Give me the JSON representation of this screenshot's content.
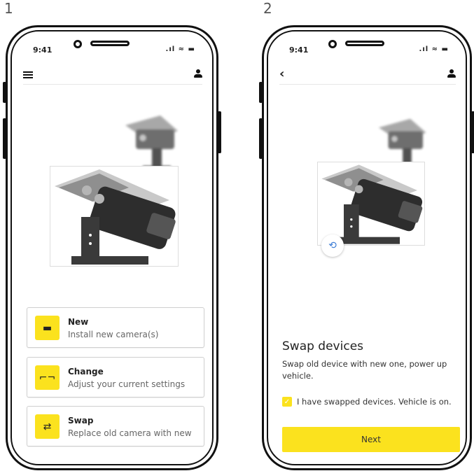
{
  "steps": {
    "first": "1",
    "second": "2"
  },
  "status_bar": {
    "time": "9:41",
    "icons_glyphs": ".ıl ≈ ▬"
  },
  "screen1": {
    "menu_icon": "hamburger-menu-icon",
    "profile_icon": "user-icon",
    "options": [
      {
        "title": "New",
        "subtitle": "Install new camera(s)",
        "icon": "camera-card-icon",
        "glyph": "▬"
      },
      {
        "title": "Change",
        "subtitle": "Adjust your current settings",
        "icon": "frame-adjust-icon",
        "glyph": "⌐¬"
      },
      {
        "title": "Swap",
        "subtitle": "Replace old camera with new",
        "icon": "swap-arrows-icon",
        "glyph": "⇄"
      }
    ]
  },
  "screen2": {
    "back_glyph": "‹",
    "profile_icon": "user-icon",
    "rotate_glyph": "⟲",
    "title": "Swap devices",
    "description": "Swap old device with new one, power up vehicle.",
    "checkbox": {
      "checked": true,
      "label": "I have swapped devices. Vehicle is on."
    },
    "next_label": "Next"
  },
  "colors": {
    "accent": "#fbe21e",
    "link": "#3a7bd5"
  }
}
